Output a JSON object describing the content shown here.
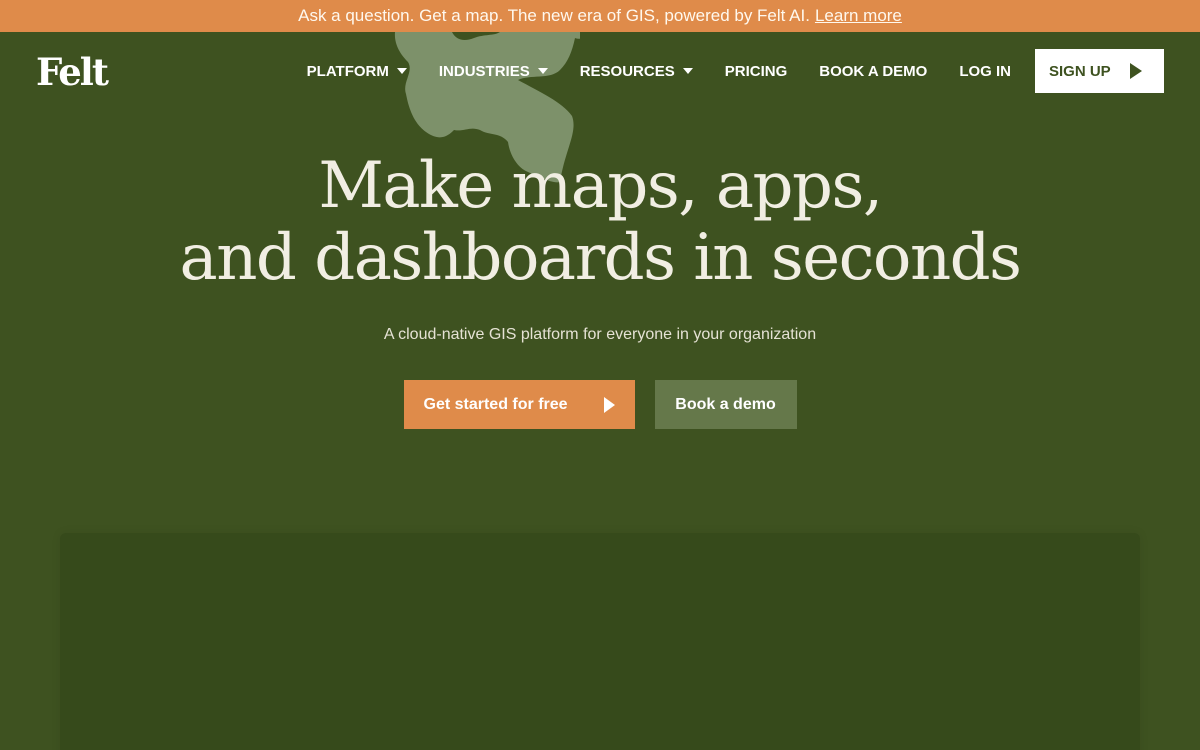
{
  "announcement": {
    "text": "Ask a question. Get a map. The new era of GIS, powered by Felt AI.",
    "link": "Learn more"
  },
  "header": {
    "logo": "Felt",
    "nav": [
      {
        "label": "PLATFORM",
        "dropdown": true
      },
      {
        "label": "INDUSTRIES",
        "dropdown": true
      },
      {
        "label": "RESOURCES",
        "dropdown": true
      },
      {
        "label": "PRICING",
        "dropdown": false
      },
      {
        "label": "BOOK A DEMO",
        "dropdown": false
      },
      {
        "label": "LOG IN",
        "dropdown": false
      }
    ],
    "signup": "SIGN UP"
  },
  "hero": {
    "headline_line1": "Make maps, apps,",
    "headline_line2": "and dashboards in seconds",
    "subhead": "A cloud-native GIS platform for everyone in your organization",
    "primary_cta": "Get started for free",
    "secondary_cta": "Book a demo"
  },
  "colors": {
    "background": "#3e5220",
    "accent": "#df8b4a",
    "secondary_button": "#65784a",
    "map_blob": "#7d916a"
  },
  "icons": [
    "caret-down-icon",
    "play-arrow-icon",
    "map-shape-decoration"
  ]
}
